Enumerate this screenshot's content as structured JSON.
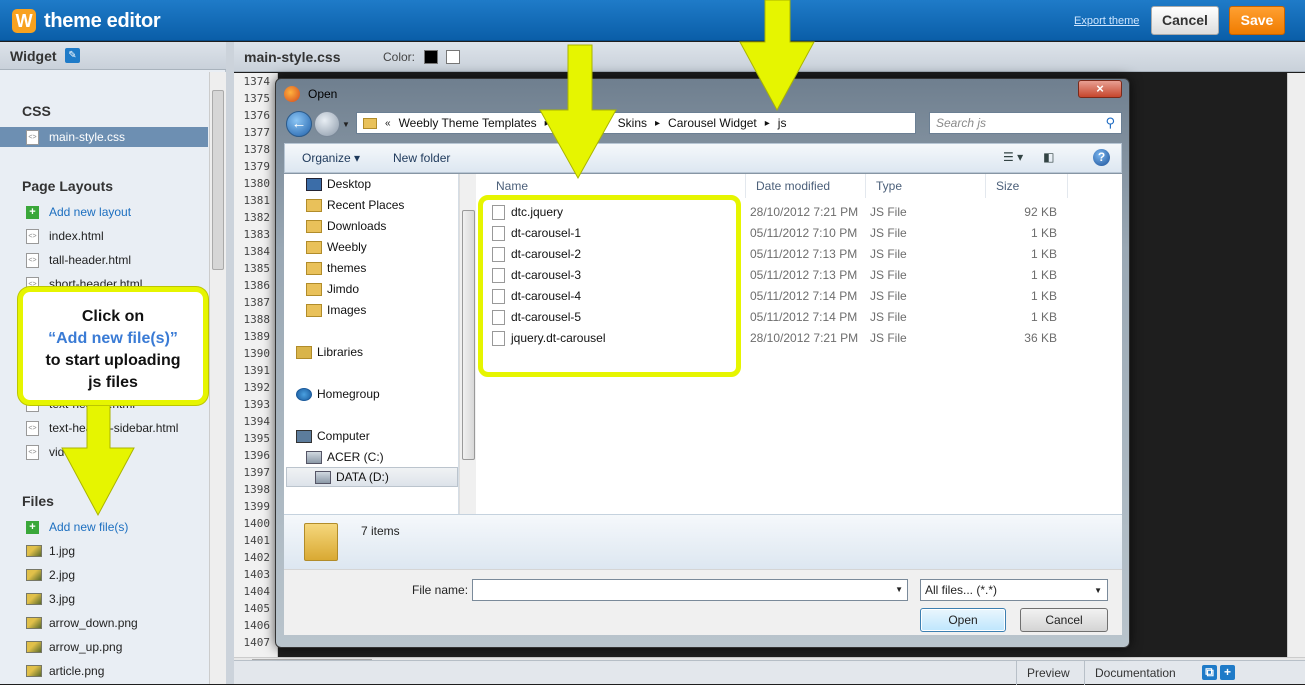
{
  "topbar": {
    "logo_letter": "W",
    "title": "theme editor",
    "export_label": "Export theme",
    "cancel_label": "Cancel",
    "save_label": "Save"
  },
  "sidebar": {
    "header": "Widget",
    "css_section": "CSS",
    "css_files": [
      "main-style.css"
    ],
    "layouts_section": "Page Layouts",
    "add_layout": "Add new layout",
    "layouts": [
      "index.html",
      "tall-header.html",
      "short-header.html",
      "text-header.html",
      "text-header-sidebar.html",
      "video.html"
    ],
    "files_section": "Files",
    "add_file": "Add new file(s)",
    "files": [
      "1.jpg",
      "2.jpg",
      "3.jpg",
      "arrow_down.png",
      "arrow_up.png",
      "article.png"
    ]
  },
  "editor": {
    "filename": "main-style.css",
    "color_label": "Color:",
    "color_swatches": [
      "#000000",
      "#ffffff"
    ],
    "line_numbers": [
      "1374",
      "1375",
      "1376",
      "1377",
      "1378",
      "1379",
      "1380",
      "1381",
      "1382",
      "1383",
      "1384",
      "1385",
      "1386",
      "1387",
      "1388",
      "1389",
      "1390",
      "1391",
      "1392",
      "1393",
      "1394",
      "1395",
      "1396",
      "1397",
      "1398",
      "1399",
      "1400",
      "1401",
      "1402",
      "1403",
      "1404",
      "1405",
      "1406",
      "1407"
    ],
    "bottom_preview": "Preview",
    "bottom_docs": "Documentation"
  },
  "dialog": {
    "title": "Open",
    "close_icon": "×",
    "address": {
      "prefix": "«",
      "crumbs": [
        "Weebly Theme Templates",
        "Skins",
        "Carousel Widget",
        "js"
      ]
    },
    "search_placeholder": "Search js",
    "organize_label": "Organize ▾",
    "new_folder_label": "New folder",
    "nav_items": [
      {
        "label": "Desktop",
        "icon": "desktop-icon"
      },
      {
        "label": "Recent Places",
        "icon": "recent-places-icon"
      },
      {
        "label": "Downloads",
        "icon": "folder-icon"
      },
      {
        "label": "Weebly",
        "icon": "folder-icon"
      },
      {
        "label": "themes",
        "icon": "folder-icon"
      },
      {
        "label": "Jimdo",
        "icon": "folder-icon"
      },
      {
        "label": "Images",
        "icon": "folder-icon"
      },
      {
        "label": "Libraries",
        "icon": "library-icon"
      },
      {
        "label": "Homegroup",
        "icon": "homegroup-icon"
      },
      {
        "label": "Computer",
        "icon": "computer-icon"
      },
      {
        "label": "ACER (C:)",
        "icon": "drive-icon"
      },
      {
        "label": "DATA (D:)",
        "icon": "drive-icon"
      }
    ],
    "columns": {
      "name": "Name",
      "date": "Date modified",
      "type": "Type",
      "size": "Size"
    },
    "files": [
      {
        "name": "dtc.jquery",
        "date": "28/10/2012 7:21 PM",
        "type": "JS File",
        "size": "92 KB"
      },
      {
        "name": "dt-carousel-1",
        "date": "05/11/2012 7:10 PM",
        "type": "JS File",
        "size": "1 KB"
      },
      {
        "name": "dt-carousel-2",
        "date": "05/11/2012 7:13 PM",
        "type": "JS File",
        "size": "1 KB"
      },
      {
        "name": "dt-carousel-3",
        "date": "05/11/2012 7:13 PM",
        "type": "JS File",
        "size": "1 KB"
      },
      {
        "name": "dt-carousel-4",
        "date": "05/11/2012 7:14 PM",
        "type": "JS File",
        "size": "1 KB"
      },
      {
        "name": "dt-carousel-5",
        "date": "05/11/2012 7:14 PM",
        "type": "JS File",
        "size": "1 KB"
      },
      {
        "name": "jquery.dt-carousel",
        "date": "28/10/2012 7:21 PM",
        "type": "JS File",
        "size": "36 KB"
      }
    ],
    "item_count": "7 items",
    "file_name_label": "File name:",
    "file_name_value": "",
    "file_type": "All files... (*.*)",
    "open_label": "Open",
    "cancel_label": "Cancel"
  },
  "annotation": {
    "line1": "Click on",
    "line2": "“Add new file(s)”",
    "line3": "to start uploading",
    "line4": "js files",
    "color": "#e6f500"
  }
}
